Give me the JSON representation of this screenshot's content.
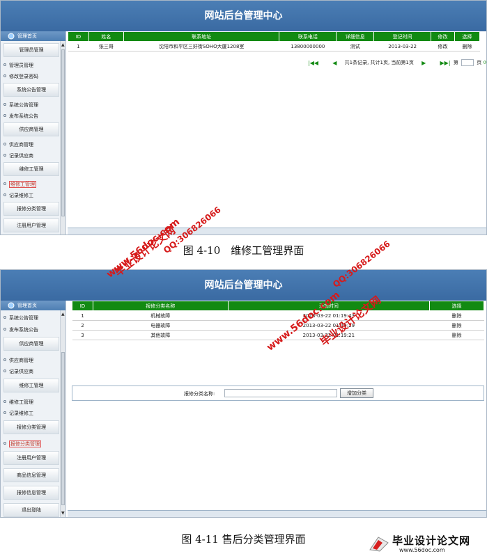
{
  "app_title": "网站后台管理中心",
  "sidebar": {
    "home": "管理首页"
  },
  "shot1": {
    "groups": [
      "管理员管理",
      "系统公告管理",
      "供应商管理",
      "维修工管理",
      "报修分类管理",
      "注册用户管理"
    ],
    "items": [
      "管理员管理",
      "修改登录密码",
      "系统公告管理",
      "发布系统公告",
      "供应商管理",
      "记录供应商",
      "维修工管理",
      "记录维修工"
    ],
    "active_item": "维修工管理",
    "table": {
      "columns": [
        "ID",
        "姓名",
        "联系地址",
        "联系电话",
        "详细信息",
        "登记时间",
        "修改",
        "选择"
      ],
      "rows": [
        [
          "1",
          "张三哥",
          "沈阳市和平区三好街SOHO大厦1208室",
          "13800000000",
          "测试",
          "2013-03-22",
          "修改",
          "删除"
        ]
      ]
    },
    "pager": {
      "summary": "共1条记录, 共计1页, 当前第1页",
      "go_prefix": "第",
      "go_suffix": "页"
    }
  },
  "caption1": "图 4-10　维修工管理界面",
  "shot2": {
    "groups": [
      "供应商管理",
      "维修工管理",
      "报修分类管理",
      "注册用户管理",
      "商品信息管理",
      "报修信息管理",
      "退出登陆"
    ],
    "items": [
      "系统公告管理",
      "发布系统公告",
      "供应商管理",
      "记录供应商",
      "维修工管理",
      "记录维修工",
      "报修分类管理"
    ],
    "active_item": "报修分类管理",
    "table": {
      "columns": [
        "ID",
        "报修分类名称",
        "添加时间",
        "选择"
      ],
      "rows": [
        [
          "1",
          "机械故障",
          "2013-03-22 01:19:43",
          "删除"
        ],
        [
          "2",
          "电器故障",
          "2013-03-22 01:19:29",
          "删除"
        ],
        [
          "3",
          "其他故障",
          "2013-03-22 01:19:21",
          "删除"
        ]
      ]
    },
    "form": {
      "label": "报修分类名称:",
      "button": "增加分类"
    }
  },
  "caption2": "图 4-11  售后分类管理界面",
  "watermarks": {
    "site": "www.56doc.com",
    "qq": "QQ:306826066",
    "brand": "毕业设计论文网"
  },
  "logo": {
    "title": "毕业设计论文网",
    "url": "www.56doc.com"
  },
  "colors": {
    "header": "#3a6aa2",
    "table_head": "#128a12",
    "watermark": "#d61a1a"
  }
}
